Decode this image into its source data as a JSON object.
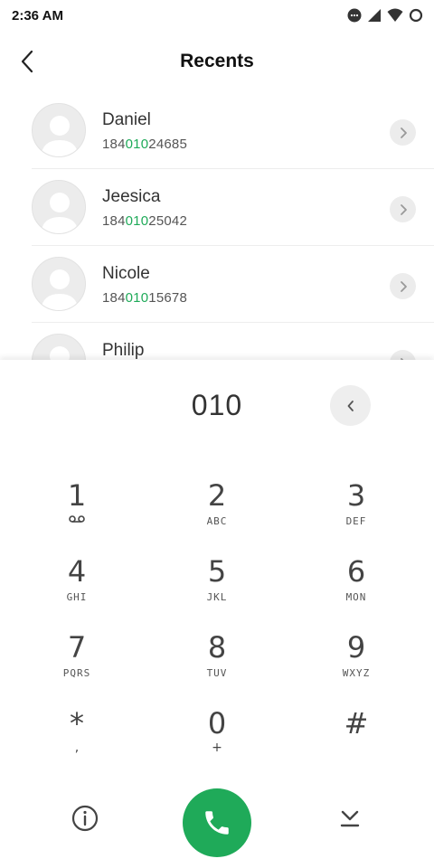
{
  "status_bar": {
    "time": "2:36 AM",
    "icons": [
      "notification-dots-icon",
      "signal-icon",
      "wifi-icon",
      "battery-icon"
    ]
  },
  "header": {
    "title": "Recents",
    "back_icon": "chevron-left-icon"
  },
  "recents": [
    {
      "name": "Daniel",
      "number_prefix": "184",
      "number_match": "010",
      "number_suffix": "24685"
    },
    {
      "name": "Jeesica",
      "number_prefix": "184",
      "number_match": "010",
      "number_suffix": "25042"
    },
    {
      "name": "Nicole",
      "number_prefix": "184",
      "number_match": "010",
      "number_suffix": "15678"
    },
    {
      "name": "Philip",
      "number_prefix": "",
      "number_match": "",
      "number_suffix": ""
    }
  ],
  "dialer": {
    "input_value": "010",
    "keys": [
      {
        "digit": "1",
        "letters": "",
        "sub_icon": "voicemail-icon"
      },
      {
        "digit": "2",
        "letters": "ABC"
      },
      {
        "digit": "3",
        "letters": "DEF"
      },
      {
        "digit": "4",
        "letters": "GHI"
      },
      {
        "digit": "5",
        "letters": "JKL"
      },
      {
        "digit": "6",
        "letters": "MON"
      },
      {
        "digit": "7",
        "letters": "PQRS"
      },
      {
        "digit": "8",
        "letters": "TUV"
      },
      {
        "digit": "9",
        "letters": "WXYZ"
      },
      {
        "digit": "*",
        "letters": ","
      },
      {
        "digit": "0",
        "letters": "+"
      },
      {
        "digit": "#",
        "letters": ""
      }
    ]
  },
  "colors": {
    "accent_green": "#1faa59",
    "chip_gray": "#ececec"
  }
}
